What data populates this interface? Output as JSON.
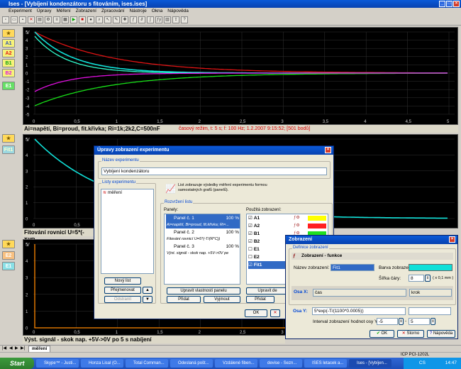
{
  "window": {
    "title": "Ises - [Vybíjení kondenzátoru s fitováním, ises.ises]"
  },
  "menu": [
    "Experiment",
    "Úpravy",
    "Měření",
    "Zobrazení",
    "Zpracování",
    "Nástroje",
    "Okna",
    "Nápověda"
  ],
  "left_channels": {
    "top": [
      "A1",
      "A2",
      "B1",
      "B2",
      "E1"
    ],
    "mid": [
      "Fit1"
    ],
    "bottom": [
      "E2",
      "E1"
    ]
  },
  "plot1": {
    "y_label": "V",
    "y_ticks": [
      "5",
      "4",
      "3",
      "2",
      "1",
      "0",
      "-1",
      "-2",
      "-3",
      "-4",
      "-5"
    ],
    "x_ticks": [
      "0",
      "0,5",
      "1",
      "1,5",
      "2",
      "2,5",
      "3",
      "3,5",
      "4",
      "4,5",
      "5"
    ],
    "x_unit": "s",
    "status": "Ai=napětí, Bi=proud, fit.křivka; Ri=1k;2k2,C=500nF",
    "status_right": "časový režim, t: 5 s; f: 100 Hz; 1.2.2007  9:15:52; [501 bodů]"
  },
  "plot2": {
    "y_label": "V",
    "y_ticks": [
      "5",
      "4",
      "3",
      "2",
      "1",
      "0"
    ],
    "x_ticks": [
      "0",
      "0,5",
      "1"
    ],
    "status": "Fitování rovnicí U=5*(-T/(R"
  },
  "plot3": {
    "y_label": "V",
    "y_ticks": [
      "5",
      "4",
      "3",
      "2",
      "1",
      "0"
    ],
    "x_ticks": [
      "0",
      "0,5",
      "1",
      "1,5",
      "2",
      "2,5",
      "3"
    ],
    "status": "Výst. signál - skok nap. +5V->0V po 5 s nabíjení"
  },
  "colors": {
    "red": "#e01414",
    "green": "#18e018",
    "magenta": "#e010e0",
    "cyan": "#10e0d8",
    "cyan2": "#30ffd0",
    "orange": "#ff8800"
  },
  "dialog_main": {
    "title": "Úpravy zobrazení experimentu",
    "name_group": "Název experimentu",
    "name_value": "Vybíjení kondenzátoru",
    "sheets_group": "Listy experimentu",
    "sheet_item": "měření",
    "info_text": "List zobrazuje výsledky měření experimentu formou samostatných grafů (panelů).",
    "layout_group": "Rozvržení listu",
    "panels_label": "Panely:",
    "panels": [
      {
        "name": "Panel č. 1",
        "pct": "100 %",
        "desc": "Ai=napětí, Bi=proud, fit.křivka; Ri=..."
      },
      {
        "name": "Panel č. 2",
        "pct": "100 %",
        "desc": "Fitování rovnicí U=5*(-T/(R*C))"
      },
      {
        "name": "Panel č. 3",
        "pct": "100 %",
        "desc": "Výst. signál - skok nap. +5V->0V pe"
      }
    ],
    "used_label": "Použitá zobrazení:",
    "used": [
      {
        "name": "A1",
        "checked": true,
        "color": "#ffff00"
      },
      {
        "name": "A2",
        "checked": true,
        "color": "#ff2020"
      },
      {
        "name": "B1",
        "checked": true,
        "color": "#20e020"
      },
      {
        "name": "B2",
        "checked": true,
        "color": "#e020e0"
      },
      {
        "name": "E1",
        "checked": false,
        "color": ""
      },
      {
        "name": "E2",
        "checked": false,
        "color": ""
      },
      {
        "name": "Fit1",
        "checked": true,
        "color": ""
      }
    ],
    "buttons": {
      "new_sheet": "Nový list",
      "rename": "Přejmenovat",
      "remove": "Odstranit",
      "edit_panel": "Upravit vlastnosti panelu",
      "add": "Přidat",
      "remove2": "Vyjmout",
      "edit_view": "Upravit de",
      "add2": "Přidat",
      "ok": "OK"
    }
  },
  "dialog_view": {
    "title": "Zobrazení",
    "def_group": "Definice zobrazení",
    "header": "Zobrazení - funkce",
    "name_label": "Název zobrazení:",
    "name_value": "Fit1",
    "color_label": "Barva zobrazení:",
    "line_label": "Šířka čáry:",
    "line_value": "8",
    "line_unit": "( x 0,1 mm )",
    "axis_x_label": "Osa X:",
    "axis_x_value": "čas",
    "axis_x_unit": "krok",
    "axis_y_label": "Osa Y:",
    "axis_y_value": "5*exp(-T/(1100*0.0005))",
    "range_label": "Interval zobrazení hodnot osy Y:",
    "range_min": "-5",
    "range_max": "5",
    "btn_ok": "OK",
    "btn_cancel": "Storno",
    "btn_help": "Nápověda"
  },
  "bottom_tab": "měření",
  "status_strip": {
    "port": "ICP PCI-1202L"
  },
  "taskbar": {
    "start": "Start",
    "tasks": [
      "Skype™ - Justi...",
      "Honza Lisal (O...",
      "Total Comman...",
      "Odeslaná pošt...",
      "Vzdálené fiben...",
      "devise - Sezn...",
      "ISES letacek a...",
      "Ises - [Vybíjen..."
    ],
    "tray_lang": "CS",
    "clock": "14:47"
  }
}
